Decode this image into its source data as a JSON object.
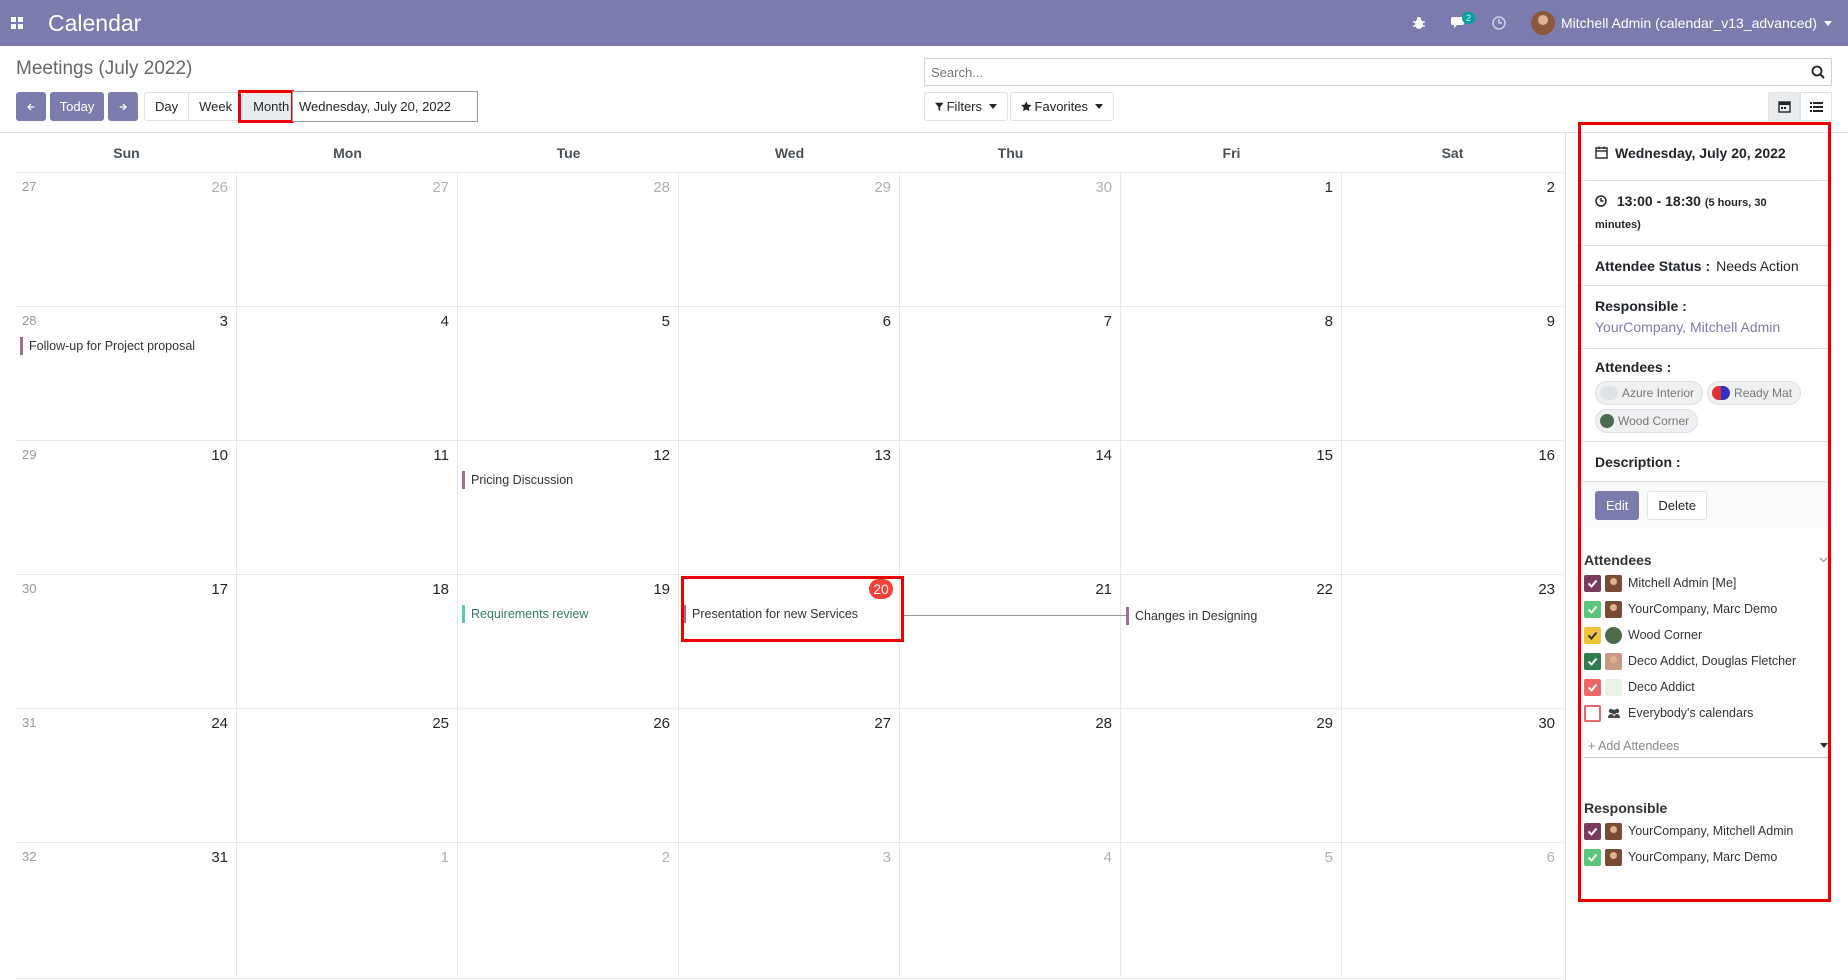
{
  "navbar": {
    "brand": "Calendar",
    "messages_count": "2",
    "user_name": "Mitchell Admin (calendar_v13_advanced)",
    "background": "#7c7bad"
  },
  "control_panel": {
    "title": "Meetings (July 2022)",
    "today_label": "Today",
    "scales": [
      "Day",
      "Week",
      "Month"
    ],
    "active_scale": "Month",
    "date_value": "Wednesday, July 20, 2022",
    "search_placeholder": "Search...",
    "filters_label": "Filters",
    "favorites_label": "Favorites"
  },
  "calendar": {
    "weekdays": [
      "Sun",
      "Mon",
      "Tue",
      "Wed",
      "Thu",
      "Fri",
      "Sat"
    ],
    "weeks": [
      {
        "num": "27",
        "days": [
          "26",
          "27",
          "28",
          "29",
          "30",
          "1",
          "2"
        ]
      },
      {
        "num": "28",
        "days": [
          "3",
          "4",
          "5",
          "6",
          "7",
          "8",
          "9"
        ]
      },
      {
        "num": "29",
        "days": [
          "10",
          "11",
          "12",
          "13",
          "14",
          "15",
          "16"
        ]
      },
      {
        "num": "30",
        "days": [
          "17",
          "18",
          "19",
          "20",
          "21",
          "22",
          "23"
        ]
      },
      {
        "num": "31",
        "days": [
          "24",
          "25",
          "26",
          "27",
          "28",
          "29",
          "30"
        ]
      },
      {
        "num": "32",
        "days": [
          "31",
          "1",
          "2",
          "3",
          "4",
          "5",
          "6"
        ]
      }
    ],
    "events": {
      "followup": "Follow-up for Project proposal",
      "pricing": "Pricing Discussion",
      "requirements": "Requirements review",
      "presentation": "Presentation for new Services",
      "changes": "Changes in Designing"
    }
  },
  "popover": {
    "date": "Wednesday, July 20, 2022",
    "time": "13:00 - 18:30",
    "duration": "(5 hours, 30 minutes)",
    "status_label": "Attendee Status :",
    "status_value": "Needs Action",
    "responsible_label": "Responsible :",
    "responsible_value": "YourCompany, Mitchell Admin",
    "attendees_label": "Attendees :",
    "attendee_tags": [
      "Azure Interior",
      "Ready Mat",
      "Wood Corner"
    ],
    "description_label": "Description :",
    "edit_label": "Edit",
    "delete_label": "Delete"
  },
  "sidebar": {
    "attendees_title": "Attendees",
    "attendees": [
      {
        "name": "Mitchell Admin [Me]",
        "color": "#7a3c5c"
      },
      {
        "name": "YourCompany, Marc Demo",
        "color": "#5ac67a"
      },
      {
        "name": "Wood Corner",
        "color": "#f2c23a"
      },
      {
        "name": "Deco Addict, Douglas Fletcher",
        "color": "#2e7d4f"
      },
      {
        "name": "Deco Addict",
        "color": "#ee6666"
      },
      {
        "name": "Everybody's calendars",
        "color": ""
      }
    ],
    "add_attendees_placeholder": "+ Add Attendees",
    "responsible_title": "Responsible",
    "responsible": [
      {
        "name": "YourCompany, Mitchell Admin",
        "color": "#7a3c5c"
      },
      {
        "name": "YourCompany, Marc Demo",
        "color": "#5ac67a"
      }
    ]
  }
}
